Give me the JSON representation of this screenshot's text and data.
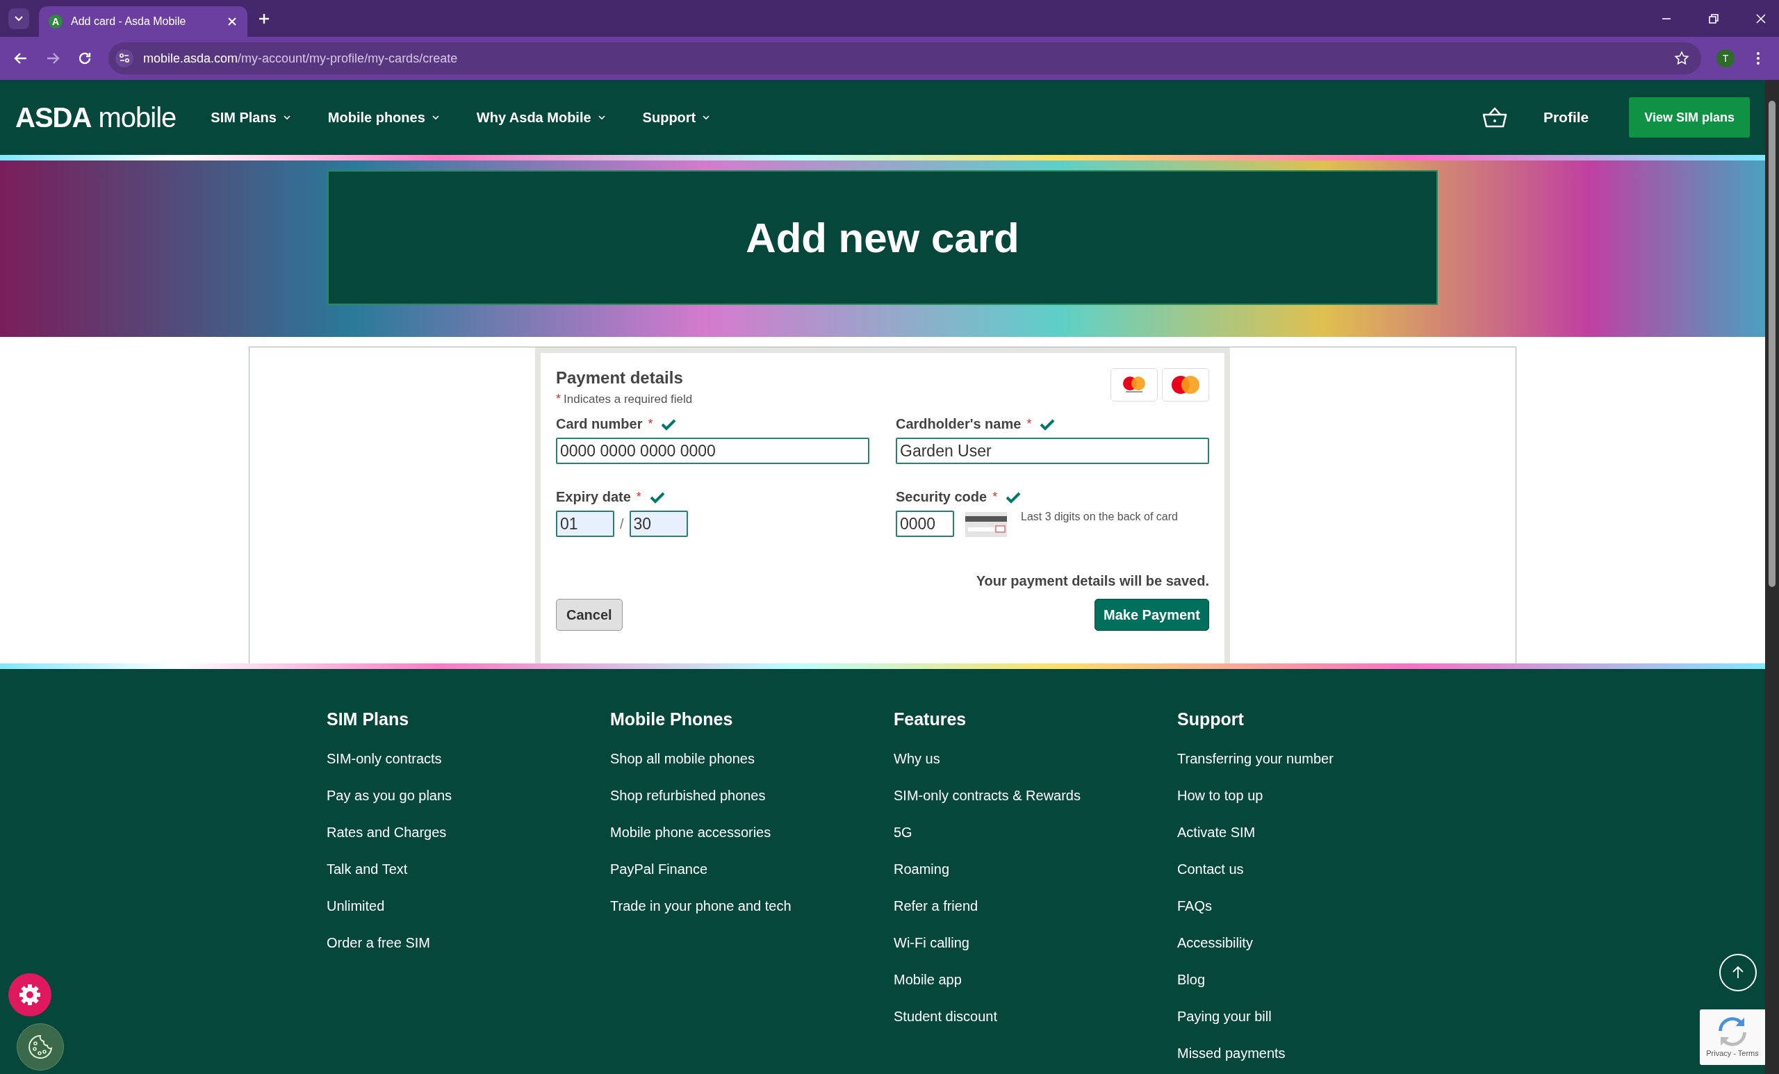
{
  "browser": {
    "tab_title": "Add card - Asda Mobile",
    "favicon_letter": "A",
    "url_host": "mobile.asda.com",
    "url_path": "/my-account/my-profile/my-cards/create",
    "profile_initial": "T"
  },
  "nav": {
    "logo_bold": "ASDA",
    "logo_light": "mobile",
    "items": [
      {
        "label": "SIM Plans"
      },
      {
        "label": "Mobile phones"
      },
      {
        "label": "Why Asda Mobile"
      },
      {
        "label": "Support"
      }
    ],
    "profile": "Profile",
    "cta": "View SIM plans"
  },
  "hero": {
    "title": "Add new card"
  },
  "form": {
    "title": "Payment details",
    "required_mark": "*",
    "required_note": "Indicates a required field",
    "fields": [
      {
        "label": "Card number",
        "valid": true,
        "value": "0000 0000 0000 0000"
      },
      {
        "label": "Cardholder's name",
        "valid": true,
        "value": "Garden User"
      }
    ],
    "expiry": {
      "label": "Expiry date",
      "valid": true,
      "month": "01",
      "separator": "/",
      "year": "30"
    },
    "security": {
      "label": "Security code",
      "valid": true,
      "value": "0000",
      "hint": "Last 3 digits on the back of card"
    },
    "save_note": "Your payment details will be saved.",
    "cancel": "Cancel",
    "submit": "Make Payment"
  },
  "footer": {
    "columns": [
      {
        "heading": "SIM Plans",
        "links": [
          "SIM-only contracts",
          "Pay as you go plans",
          "Rates and Charges",
          "Talk and Text",
          "Unlimited",
          "Order a free SIM"
        ]
      },
      {
        "heading": "Mobile Phones",
        "links": [
          "Shop all mobile phones",
          "Shop refurbished phones",
          "Mobile phone accessories",
          "PayPal Finance",
          "Trade in your phone and tech"
        ]
      },
      {
        "heading": "Features",
        "links": [
          "Why us",
          "SIM-only contracts & Rewards",
          "5G",
          "Roaming",
          "Refer a friend",
          "Wi-Fi calling",
          "Mobile app",
          "Student discount"
        ]
      },
      {
        "heading": "Support",
        "links": [
          "Transferring your number",
          "How to top up",
          "Activate SIM",
          "Contact us",
          "FAQs",
          "Accessibility",
          "Blog",
          "Paying your bill",
          "Missed payments"
        ]
      }
    ]
  },
  "recaptcha": {
    "links": "Privacy - Terms"
  }
}
